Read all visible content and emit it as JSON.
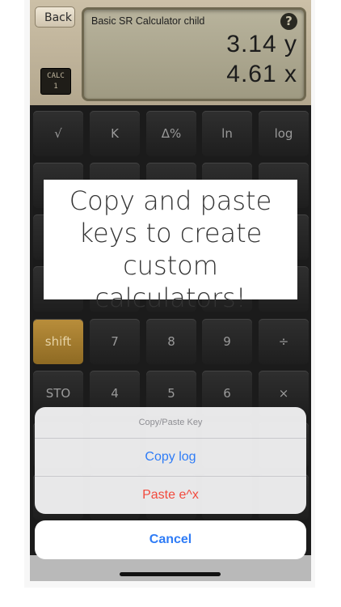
{
  "header": {
    "back_label": "Back",
    "calc_badge": [
      "CALC",
      "1"
    ],
    "display_title": "Basic SR Calculator child",
    "help_icon": "?",
    "display_lines": [
      "3.14 y",
      "4.61 x"
    ]
  },
  "keypad": {
    "row1": [
      "√",
      "K",
      "Δ%",
      "ln",
      "log"
    ],
    "row5": [
      "shift",
      "7",
      "8",
      "9",
      "÷"
    ],
    "row6": [
      "STO",
      "4",
      "5",
      "6",
      "×"
    ]
  },
  "popup": {
    "text": "Copy and paste keys to create custom calculators!"
  },
  "action_sheet": {
    "title": "Copy/Paste Key",
    "copy_label": "Copy log",
    "paste_label": "Paste e^x",
    "cancel_label": "Cancel"
  },
  "colors": {
    "accent_blue": "#2f7cf6",
    "destructive_red": "#f24a3d",
    "shift_gold": "#b98e3b"
  }
}
